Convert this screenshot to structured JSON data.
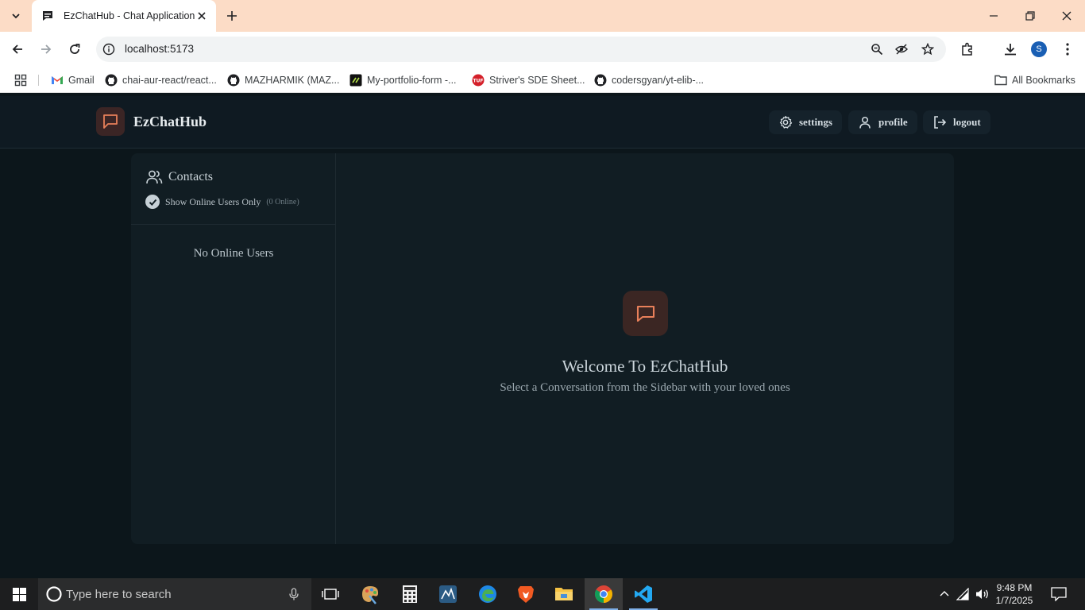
{
  "browser": {
    "tab_title": "EzChatHub - Chat Application",
    "url": "localhost:5173",
    "profile_initial": "S",
    "bookmarks": [
      {
        "label": "Gmail",
        "icon": "gmail-icon"
      },
      {
        "label": "chai-aur-react/react...",
        "icon": "github-icon"
      },
      {
        "label": "MAZHARMIK (MAZ...",
        "icon": "github-icon"
      },
      {
        "label": "My-portfolio-form -...",
        "icon": "portfolio-icon"
      },
      {
        "label": "Striver's SDE Sheet...",
        "icon": "tuf-icon"
      },
      {
        "label": "codersgyan/yt-elib-...",
        "icon": "github-icon"
      }
    ],
    "all_bookmarks": "All Bookmarks"
  },
  "app": {
    "brand": "EzChatHub",
    "nav": {
      "settings": "settings",
      "profile": "profile",
      "logout": "logout"
    },
    "sidebar": {
      "title": "Contacts",
      "toggle_label": "Show Online Users Only",
      "online_count": "(0 Online)",
      "empty": "No Online Users"
    },
    "welcome": {
      "title": "Welcome To EzChatHub",
      "subtitle": "Select a Conversation from the Sidebar with your loved ones"
    },
    "colors": {
      "accent": "#e8805a",
      "background": "#0c161b",
      "panel": "#111d23"
    }
  },
  "taskbar": {
    "search_placeholder": "Type here to search",
    "time": "9:48 PM",
    "date": "1/7/2025"
  }
}
